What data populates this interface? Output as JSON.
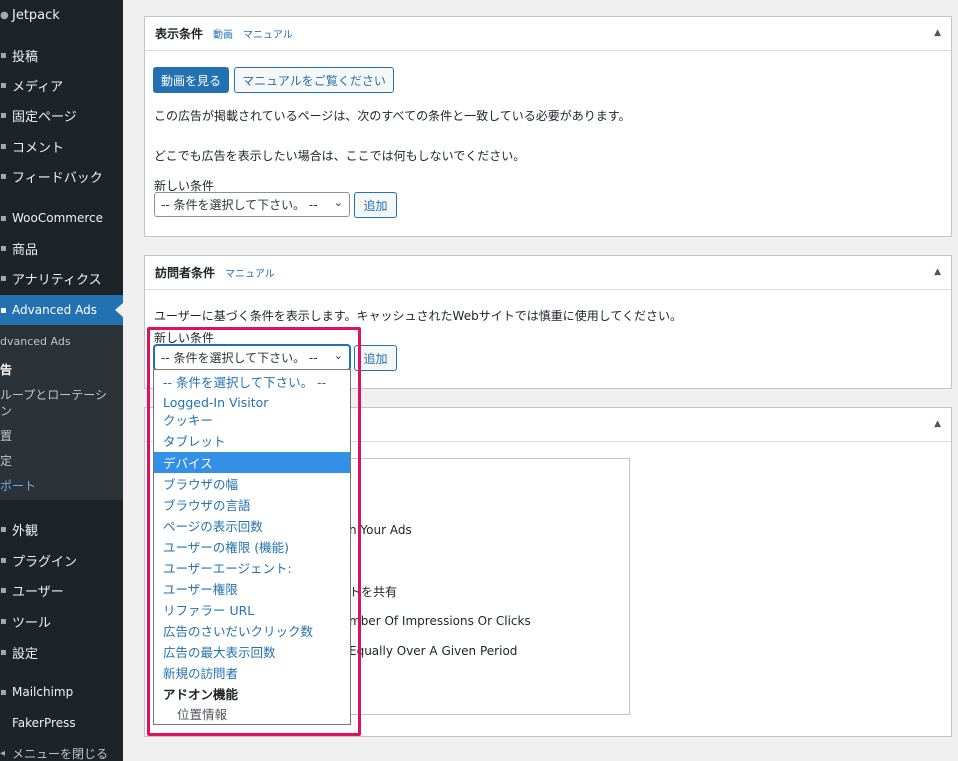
{
  "sidebar": {
    "items": [
      {
        "label": "Jetpack",
        "icon": "jetpack-icon"
      },
      {
        "label": "投稿",
        "icon": "pin-icon"
      },
      {
        "label": "メディア",
        "icon": "media-icon"
      },
      {
        "label": "固定ページ",
        "icon": "page-icon"
      },
      {
        "label": "コメント",
        "icon": "comment-icon"
      },
      {
        "label": "フィードバック",
        "icon": "feedback-icon"
      },
      {
        "label": "WooCommerce",
        "icon": "woocommerce-icon"
      },
      {
        "label": "商品",
        "icon": "product-icon"
      },
      {
        "label": "アナリティクス",
        "icon": "analytics-icon"
      },
      {
        "label": "Advanced Ads",
        "icon": "advanced-ads-icon"
      },
      {
        "label": "外観",
        "icon": "appearance-icon"
      },
      {
        "label": "プラグイン",
        "icon": "plugin-icon"
      },
      {
        "label": "ユーザー",
        "icon": "user-icon"
      },
      {
        "label": "ツール",
        "icon": "tools-icon"
      },
      {
        "label": "設定",
        "icon": "settings-icon"
      },
      {
        "label": "Mailchimp",
        "icon": "mailchimp-icon"
      },
      {
        "label": "FakerPress",
        "icon": "fakerpress-icon"
      },
      {
        "label": "メニューを閉じる",
        "icon": "collapse-icon"
      }
    ],
    "submenu": [
      {
        "label": "dvanced Ads"
      },
      {
        "label": "告"
      },
      {
        "label": "ループとローテーシ"
      },
      {
        "label": "ン"
      },
      {
        "label": "置"
      },
      {
        "label": "定"
      },
      {
        "label": "ポート"
      }
    ]
  },
  "display_conditions": {
    "title": "表示条件",
    "link_video": "動画",
    "link_manual": "マニュアル",
    "btn_video": "動画を見る",
    "btn_manual": "マニュアルをご覧ください",
    "description1": "この広告が掲載されているページは、次のすべての条件と一致している必要があります。",
    "description2": "どこでも広告を表示したい場合は、ここでは何もしないでください。",
    "new_condition_label": "新しい条件",
    "select_value": "-- 条件を選択して下さい。 --",
    "add_button": "追加"
  },
  "visitor_conditions": {
    "title": "訪問者条件",
    "link_manual": "マニュアル",
    "description": "ユーザーに基づく条件を表示します。キャッシュされたWebサイトでは慎重に使用してください。",
    "new_condition_label": "新しい条件",
    "select_value": "-- 条件を選択して下さい。 --",
    "add_button": "追加"
  },
  "dropdown": {
    "options": [
      {
        "label": "-- 条件を選択して下さい。 --",
        "type": "normal"
      },
      {
        "label": "Logged-In Visitor",
        "type": "normal"
      },
      {
        "label": "クッキー",
        "type": "normal"
      },
      {
        "label": "タブレット",
        "type": "normal"
      },
      {
        "label": "デバイス",
        "type": "selected"
      },
      {
        "label": "ブラウザの幅",
        "type": "normal"
      },
      {
        "label": "ブラウザの言語",
        "type": "normal"
      },
      {
        "label": "ページの表示回数",
        "type": "normal"
      },
      {
        "label": "ユーザーの権限 (機能)",
        "type": "normal"
      },
      {
        "label": "ユーザーエージェント:",
        "type": "normal"
      },
      {
        "label": "ユーザー権限",
        "type": "normal"
      },
      {
        "label": "リファラー URL",
        "type": "normal"
      },
      {
        "label": "広告のさいだいクリック数",
        "type": "normal"
      },
      {
        "label": "広告の最大表示回数",
        "type": "normal"
      },
      {
        "label": "新規の訪問者",
        "type": "normal"
      },
      {
        "label": "アドオン機能",
        "type": "group"
      },
      {
        "label": "位置情報",
        "type": "sub"
      }
    ]
  },
  "background_panel": {
    "partial_texts": [
      "n Your Ads",
      "トを共有",
      "mber Of Impressions Or Clicks",
      "Equally Over A Given Period"
    ]
  },
  "colors": {
    "accent": "#2271b1",
    "sidebar_bg": "#1d2327",
    "highlight": "#e0115f",
    "selected_option": "#3390e6"
  }
}
